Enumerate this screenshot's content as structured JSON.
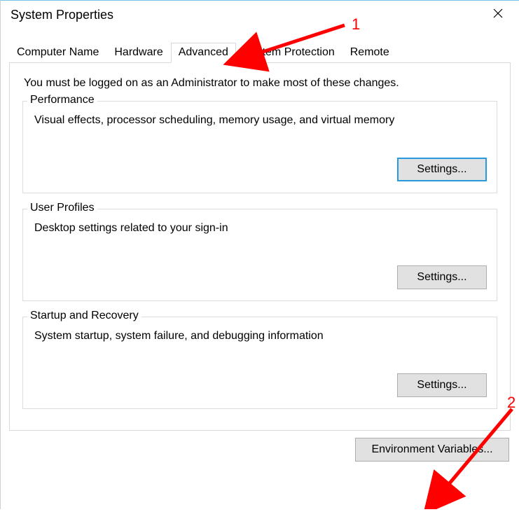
{
  "window": {
    "title": "System Properties"
  },
  "tabs": [
    {
      "label": "Computer Name"
    },
    {
      "label": "Hardware"
    },
    {
      "label": "Advanced"
    },
    {
      "label": "System Protection"
    },
    {
      "label": "Remote"
    }
  ],
  "active_tab": "Advanced",
  "intro_text": "You must be logged on as an Administrator to make most of these changes.",
  "groups": {
    "performance": {
      "title": "Performance",
      "desc": "Visual effects, processor scheduling, memory usage, and virtual memory",
      "button": "Settings..."
    },
    "user_profiles": {
      "title": "User Profiles",
      "desc": "Desktop settings related to your sign-in",
      "button": "Settings..."
    },
    "startup": {
      "title": "Startup and Recovery",
      "desc": "System startup, system failure, and debugging information",
      "button": "Settings..."
    }
  },
  "env_button": "Environment Variables...",
  "annotations": {
    "one": "1",
    "two": "2"
  }
}
